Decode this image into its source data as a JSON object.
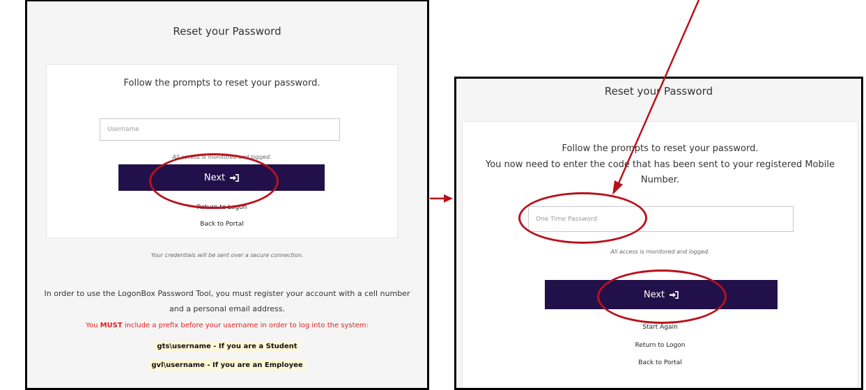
{
  "left_panel": {
    "title": "Reset your Password",
    "prompt": "Follow the prompts to reset your password.",
    "username_placeholder": "Username",
    "access_notice": "All access is monitored and logged.",
    "next_label": "Next",
    "return_link": "Return to Logon",
    "portal_link": "Back to Portal",
    "secure_notice": "Your credentials will be sent over a secure connection.",
    "info_line1": "In order to use the LogonBox Password Tool, you must register your account with a cell number",
    "info_line2": "and a personal email address.",
    "must_prefix": "You ",
    "must_word": "MUST",
    "must_suffix": " include a prefix before your username in order to log into the system:",
    "student_prefix": "gts\\username - If you are a Student",
    "employee_prefix": "gvl\\username - If you are an Employee"
  },
  "right_panel": {
    "title": "Reset your Password",
    "prompt": "Follow the prompts to reset your password.",
    "code_line1": "You now need to enter the code that has been sent to your registered Mobile",
    "code_line2": "Number.",
    "otp_placeholder": "One Time Password",
    "access_notice": "All access is monitored and logged.",
    "next_label": "Next",
    "start_again_link": "Start Again",
    "return_link": "Return to Logon",
    "portal_link": "Back to Portal"
  },
  "colors": {
    "button": "#22104a",
    "annotation": "#b8121c",
    "must_text": "#e02020",
    "highlight": "#fff8d9"
  },
  "icons": {
    "next_icon": "sign-in-icon"
  }
}
